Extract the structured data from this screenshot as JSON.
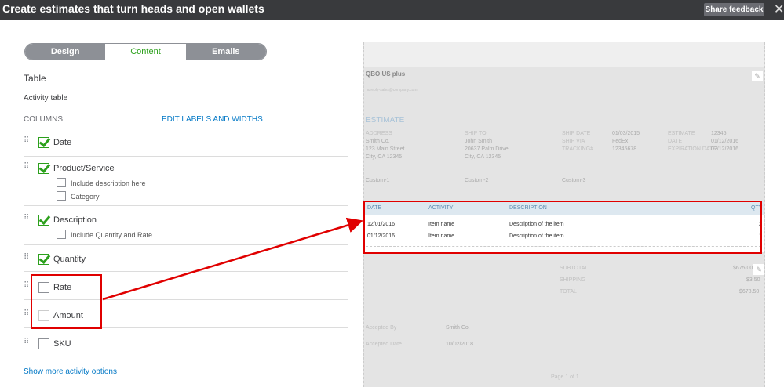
{
  "window": {
    "title": "Create estimates that turn heads and open wallets",
    "share_feedback": "Share feedback",
    "close": "✕"
  },
  "tabs": [
    {
      "label": "Design"
    },
    {
      "label": "Content"
    },
    {
      "label": "Emails"
    }
  ],
  "panel": {
    "section": "Table",
    "subsection": "Activity table",
    "columns_label": "COLUMNS",
    "edit_link": "EDIT LABELS AND WIDTHS",
    "columns": [
      {
        "label": "Date",
        "checked": true
      },
      {
        "label": "Product/Service",
        "checked": true,
        "options": [
          {
            "label": "Include description here",
            "checked": false
          },
          {
            "label": "Category",
            "checked": false
          }
        ]
      },
      {
        "label": "Description",
        "checked": true,
        "options": [
          {
            "label": "Include Quantity and Rate",
            "checked": false
          }
        ]
      },
      {
        "label": "Quantity",
        "checked": true
      },
      {
        "label": "Rate",
        "checked": false
      },
      {
        "label": "Amount",
        "checked": false
      },
      {
        "label": "SKU",
        "checked": false
      }
    ],
    "show_more": "Show more activity options"
  },
  "preview": {
    "company": "QBO US plus",
    "email": "noreply-sales@company.com",
    "doc_title": "ESTIMATE",
    "address_label": "ADDRESS",
    "address": [
      "Smith Co.",
      "123 Main Street",
      "City, CA 12345"
    ],
    "shipto_label": "SHIP TO",
    "shipto": [
      "John Smith",
      "20637 Palm Drive",
      "City, CA 12345"
    ],
    "ship_labels": [
      "SHIP DATE",
      "SHIP VIA",
      "TRACKING#"
    ],
    "ship_values": [
      "01/03/2015",
      "FedEx",
      "12345678"
    ],
    "est_labels": [
      "ESTIMATE",
      "DATE",
      "EXPIRATION DATE"
    ],
    "est_values": [
      "12345",
      "01/12/2016",
      "02/12/2016"
    ],
    "custom": [
      "Custom-1",
      "Custom-2",
      "Custom-3"
    ],
    "table_headers": [
      "DATE",
      "ACTIVITY",
      "DESCRIPTION",
      "QTY"
    ],
    "rows": [
      [
        "12/01/2016",
        "Item name",
        "Description of the item",
        "2"
      ],
      [
        "01/12/2016",
        "Item name",
        "Description of the item",
        "1"
      ]
    ],
    "totals": [
      [
        "SUBTOTAL",
        "$675.00"
      ],
      [
        "SHIPPING",
        "$3.50"
      ],
      [
        "TOTAL",
        "$678.50"
      ]
    ],
    "accepted_by_label": "Accepted By",
    "accepted_by": "Smith Co.",
    "accepted_date_label": "Accepted Date",
    "accepted_date": "10/02/2018",
    "page": "Page 1 of 1"
  },
  "colors": {
    "accent": "#2ca01c",
    "highlight": "#e00000",
    "link": "#0077c5"
  }
}
